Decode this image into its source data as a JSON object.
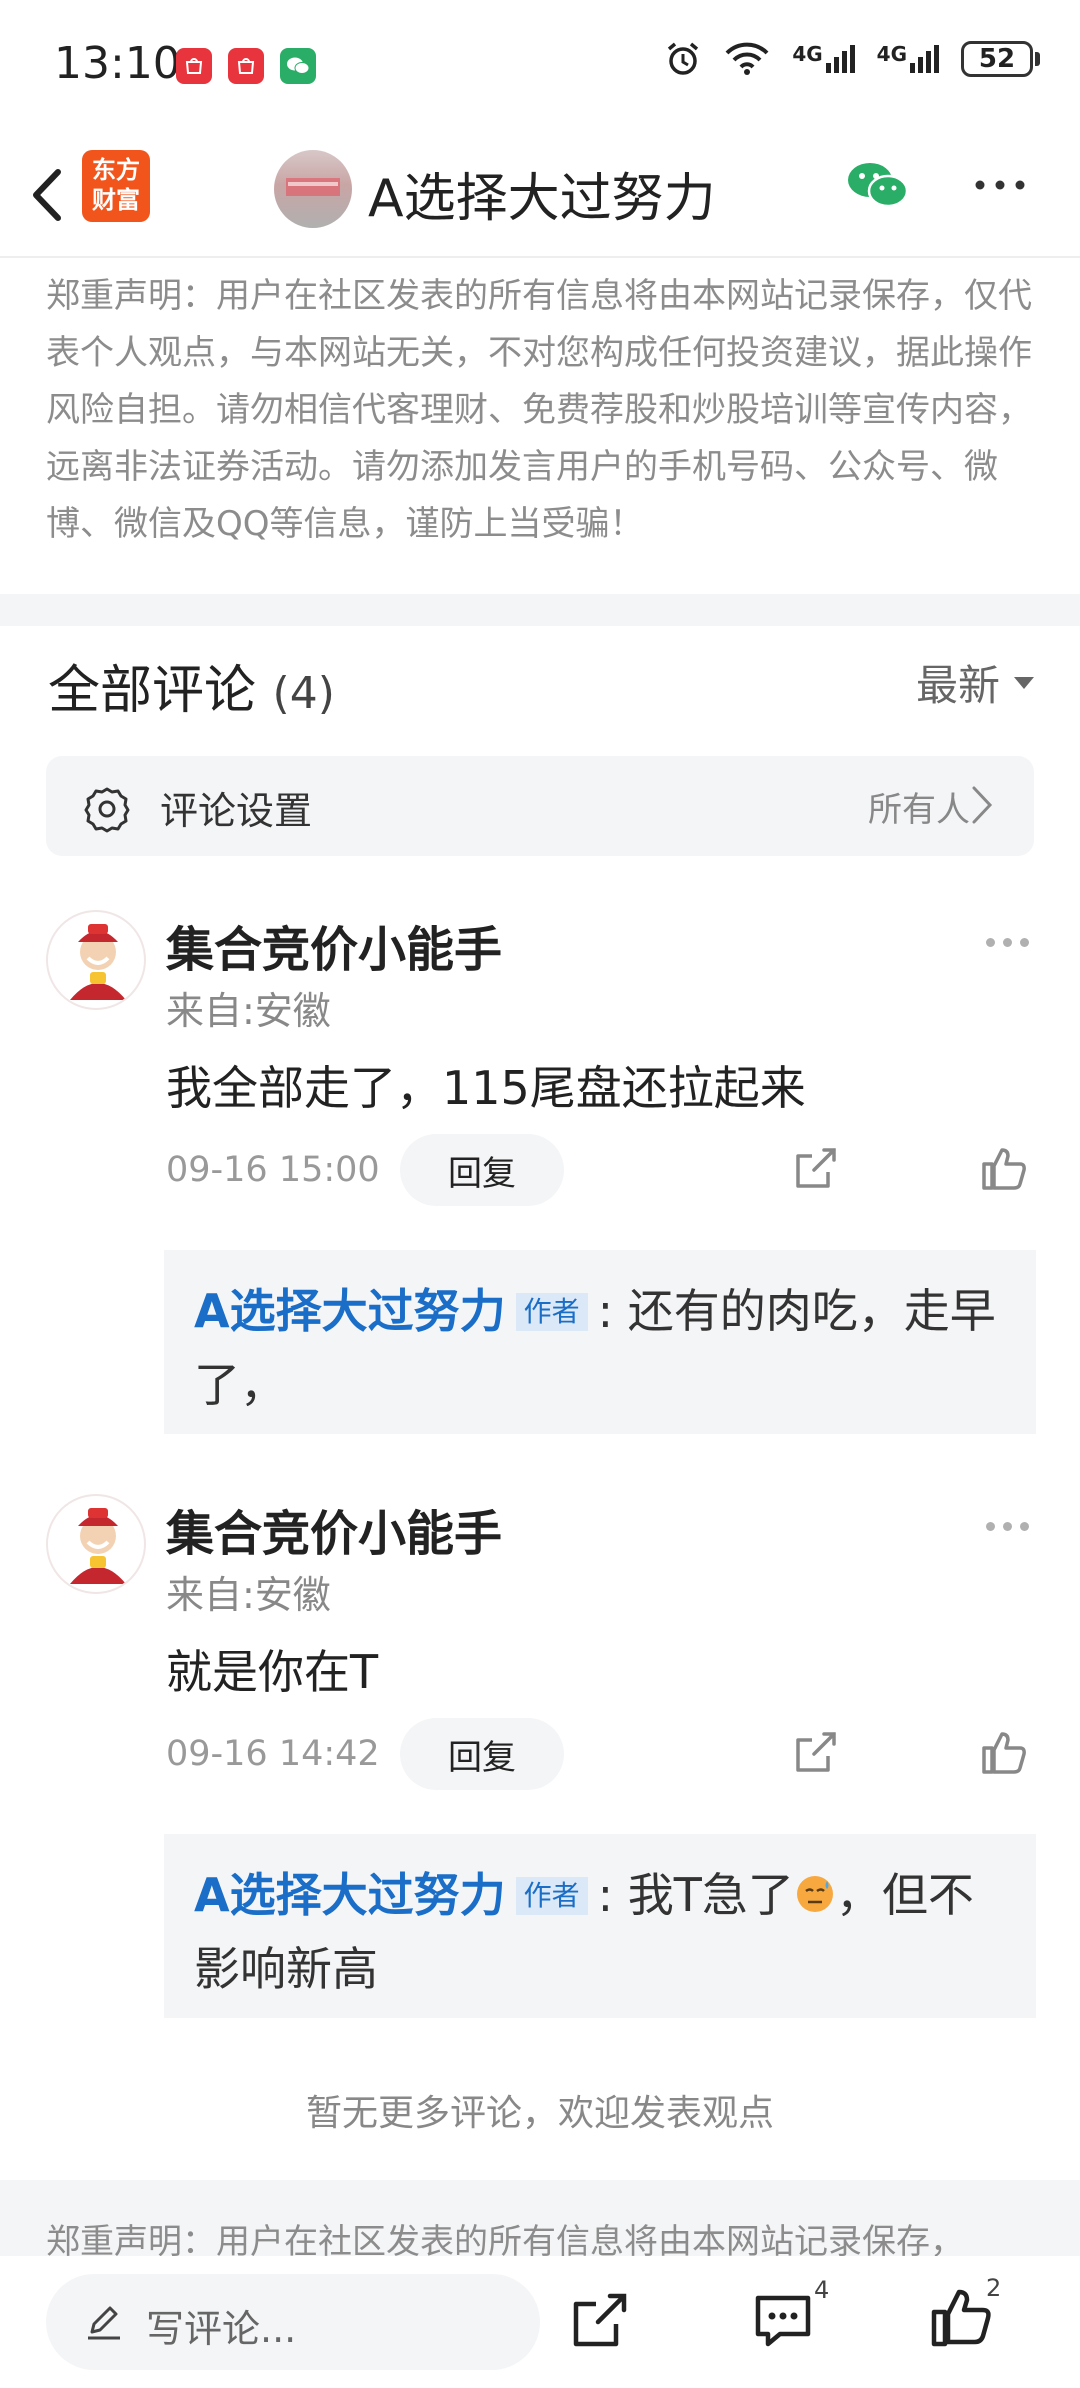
{
  "status_bar": {
    "time": "13:10",
    "network_1": "4G",
    "network_2": "4G",
    "battery": "52"
  },
  "header": {
    "logo_line1": "东方",
    "logo_line2": "财富",
    "title": "A选择大过努力"
  },
  "disclaimer": {
    "text": "郑重声明：用户在社区发表的所有信息将由本网站记录保存，仅代表个人观点，与本网站无关，不对您构成任何投资建议，据此操作风险自担。请勿相信代客理财、免费荐股和炒股培训等宣传内容，远离非法证券活动。请勿添加发言用户的手机号码、公众号、微博、微信及QQ等信息，谨防上当受骗！"
  },
  "comments_section": {
    "title": "全部评论",
    "count": "(4)",
    "sort_label": "最新",
    "settings_label": "评论设置",
    "settings_value": "所有人"
  },
  "comments": [
    {
      "name": "集合竞价小能手",
      "location": "来自:安徽",
      "text": "我全部走了，115尾盘还拉起来",
      "time": "09-16 15:00",
      "reply_label": "回复",
      "reply": {
        "author": "A选择大过努力",
        "tag": "作者",
        "text": ": 还有的肉吃，走早了，"
      }
    },
    {
      "name": "集合竞价小能手",
      "location": "来自:安徽",
      "text": "就是你在T",
      "time": "09-16 14:42",
      "reply_label": "回复",
      "reply": {
        "author": "A选择大过努力",
        "tag": "作者",
        "text_before": ": 我T急了",
        "text_after": "，但不影响新高"
      }
    }
  ],
  "footer": {
    "no_more": "暂无更多评论，欢迎发表观点",
    "disclaimer_peek": "郑重声明：用户在社区发表的所有信息将由本网站记录保存，"
  },
  "bottom_bar": {
    "compose_placeholder": "写评论...",
    "comment_count": "4",
    "like_count": "2"
  },
  "icons": [
    "back-icon",
    "wechat-icon",
    "more-icon",
    "gear-icon",
    "chevron-right-icon",
    "share-icon",
    "like-icon",
    "pencil-icon",
    "comment-icon",
    "alarm-icon",
    "wifi-icon"
  ],
  "colors": {
    "brand": "#f2551c",
    "link_blue": "#1a6ec7",
    "wechat_green": "#2aae67"
  }
}
